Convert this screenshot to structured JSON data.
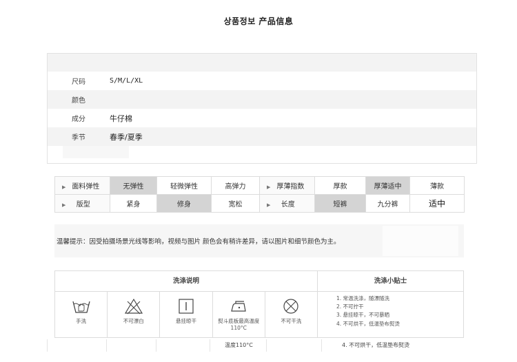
{
  "title": "상품정보 产品信息",
  "info": {
    "rows": [
      {
        "label": "尺码",
        "value": "S/M/L/XL"
      },
      {
        "label": "颜色",
        "value": ""
      },
      {
        "label": "成分",
        "value": "牛仔棉"
      },
      {
        "label": "季节",
        "value": "春季/夏季"
      }
    ]
  },
  "attributes": {
    "row1": {
      "label1": "面料弹性",
      "opts1": [
        "无弹性",
        "轻微弹性",
        "高弹力"
      ],
      "label2": "厚薄指数",
      "opts2": [
        "厚款",
        "厚薄适中",
        "薄款"
      ]
    },
    "row2": {
      "label1": "版型",
      "opts1": [
        "紧身",
        "修身",
        "宽松"
      ],
      "label2": "长度",
      "opts2": [
        "短裤",
        "九分裤",
        "适中"
      ]
    },
    "selected_color": "#d4d4d4"
  },
  "tip": "温馨提示：因受拍摄场景光线等影响，视频与图片 颜色会有稍许差异，请以图片和细节颜色为主。",
  "wash": {
    "title": "洗涤说明",
    "icons": [
      {
        "icon": "hand-wash-icon",
        "label": "手洗"
      },
      {
        "icon": "no-bleach-icon",
        "label": "不可漂白"
      },
      {
        "icon": "hang-dry-icon",
        "label": "悬挂晾干"
      },
      {
        "icon": "iron-icon",
        "label": "熨斗底板最高温度110°C"
      },
      {
        "icon": "no-dry-clean-icon",
        "label": "不可干洗"
      }
    ],
    "tips_title": "洗涤小贴士",
    "tips": [
      "1. 常温洗涤，随漂随洗",
      "2. 不可拧干",
      "3. 悬挂晾干，不可暴晒",
      "4. 不可烘干，低温垫布熨烫"
    ]
  },
  "bottom": {
    "temp": "温度110°C",
    "tip4": "4. 不可烘干，低温垫布熨烫"
  }
}
